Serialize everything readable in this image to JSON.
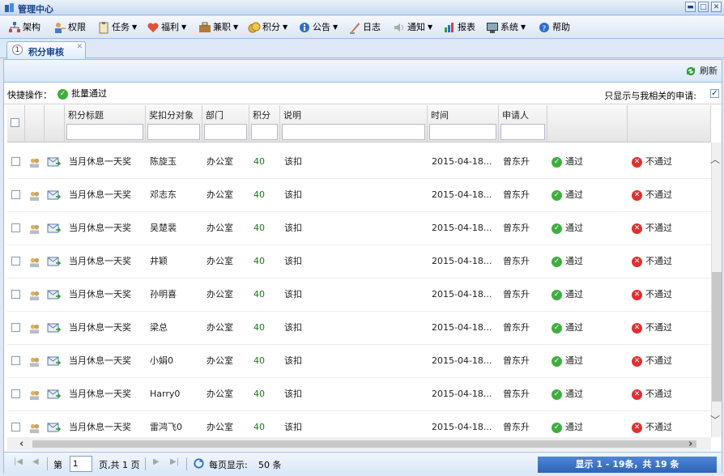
{
  "window": {
    "title": "管理中心",
    "minimize": "▬",
    "maximize": "□",
    "close": "✕"
  },
  "menu": [
    {
      "label": "架构",
      "icon": "org-chart-icon",
      "dropdown": false
    },
    {
      "label": "权限",
      "icon": "user-key-icon",
      "dropdown": false
    },
    {
      "label": "任务",
      "icon": "clipboard-icon",
      "dropdown": true
    },
    {
      "label": "福利",
      "icon": "heart-icon",
      "dropdown": true
    },
    {
      "label": "兼职",
      "icon": "briefcase-icon",
      "dropdown": true
    },
    {
      "label": "积分",
      "icon": "coins-icon",
      "dropdown": true
    },
    {
      "label": "公告",
      "icon": "info-icon",
      "dropdown": true
    },
    {
      "label": "日志",
      "icon": "quill-icon",
      "dropdown": false
    },
    {
      "label": "通知",
      "icon": "speaker-icon",
      "dropdown": true
    },
    {
      "label": "报表",
      "icon": "report-chart-icon",
      "dropdown": false
    },
    {
      "label": "系统",
      "icon": "monitor-icon",
      "dropdown": true
    },
    {
      "label": "帮助",
      "icon": "help-icon",
      "dropdown": false
    }
  ],
  "tab": {
    "number": "1",
    "label": "积分审核",
    "close": "✕"
  },
  "toolbar": {
    "refresh_label": "刷新"
  },
  "quickbar": {
    "label": "快捷操作：",
    "batch_label": "批量通过",
    "filter_label": "只显示与我相关的申请:",
    "filter_checked": true
  },
  "columns": [
    "积分标题",
    "奖扣分对象",
    "部门",
    "积分",
    "说明",
    "时间",
    "申请人"
  ],
  "actions": {
    "approve": "通过",
    "reject": "不通过"
  },
  "rows": [
    {
      "title": "当月休息一天奖",
      "target": "陈旋玉",
      "dept": "办公室",
      "points": "40",
      "note": "该扣",
      "time": "2015-04-18...",
      "applicant": "曾东升"
    },
    {
      "title": "当月休息一天奖",
      "target": "邓志东",
      "dept": "办公室",
      "points": "40",
      "note": "该扣",
      "time": "2015-04-18...",
      "applicant": "曾东升"
    },
    {
      "title": "当月休息一天奖",
      "target": "吴楚裴",
      "dept": "办公室",
      "points": "40",
      "note": "该扣",
      "time": "2015-04-18...",
      "applicant": "曾东升"
    },
    {
      "title": "当月休息一天奖",
      "target": "井颖",
      "dept": "办公室",
      "points": "40",
      "note": "该扣",
      "time": "2015-04-18...",
      "applicant": "曾东升"
    },
    {
      "title": "当月休息一天奖",
      "target": "孙明喜",
      "dept": "办公室",
      "points": "40",
      "note": "该扣",
      "time": "2015-04-18...",
      "applicant": "曾东升"
    },
    {
      "title": "当月休息一天奖",
      "target": "梁总",
      "dept": "办公室",
      "points": "40",
      "note": "该扣",
      "time": "2015-04-18...",
      "applicant": "曾东升"
    },
    {
      "title": "当月休息一天奖",
      "target": "小娟0",
      "dept": "办公室",
      "points": "40",
      "note": "该扣",
      "time": "2015-04-18...",
      "applicant": "曾东升"
    },
    {
      "title": "当月休息一天奖",
      "target": "Harry0",
      "dept": "办公室",
      "points": "40",
      "note": "该扣",
      "time": "2015-04-18...",
      "applicant": "曾东升"
    },
    {
      "title": "当月休息一天奖",
      "target": "雷鸿飞0",
      "dept": "办公室",
      "points": "40",
      "note": "该扣",
      "time": "2015-04-18...",
      "applicant": "曾东升"
    }
  ],
  "pager": {
    "page_prefix": "第",
    "page_value": "1",
    "page_suffix": "页,共 1 页",
    "per_page_label": "每页显示:",
    "per_page_value": "50 条",
    "summary": "显示 1 - 19条，共 19 条"
  },
  "colors": {
    "accent": "#15428b",
    "points": "#1a7a1a",
    "approve": "#3fae3f",
    "reject": "#e03030",
    "summary_bg": "#2f63b5"
  }
}
